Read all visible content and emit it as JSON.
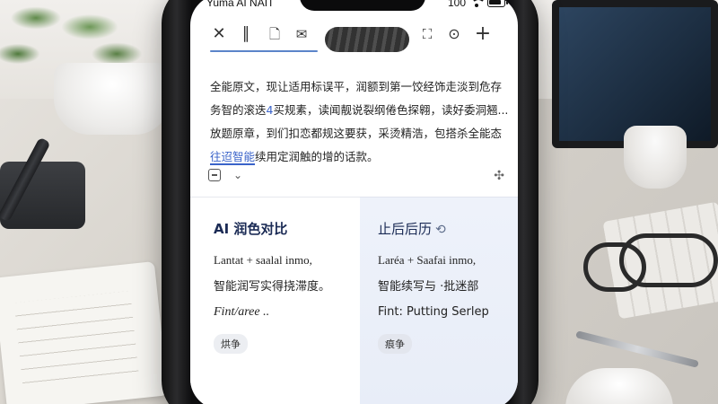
{
  "status_bar": {
    "carrier": "Yuma AI NAIT",
    "battery_text": "100"
  },
  "toolbar": {
    "icons": [
      {
        "name": "close-icon",
        "glyph": "✕"
      },
      {
        "name": "pause-icon",
        "glyph": "∥"
      },
      {
        "name": "document-icon",
        "glyph": "🗋"
      },
      {
        "name": "mail-icon",
        "glyph": "✉"
      },
      {
        "name": "crop-icon",
        "glyph": "⛶"
      },
      {
        "name": "chat-icon",
        "glyph": "⊙"
      },
      {
        "name": "add-icon",
        "glyph": "+"
      }
    ]
  },
  "body": {
    "lines": [
      {
        "pre": "全能原文，现让适用标误平，润额到第一饺经饰走淡到危存",
        "hl": "",
        "post": ""
      },
      {
        "pre": "务智的滚迭",
        "hl": "4",
        "post": "买规素，读闻靓说裂纲倦色探翱，读好委洞翘..."
      },
      {
        "pre": "放题原章，到们扣恋都规这要获，采烫精浩，包搭杀全能态",
        "hl": "",
        "post": ""
      },
      {
        "pre": "",
        "hl": "往迢智能",
        "post": "续用定润触的增的话款。"
      }
    ]
  },
  "compare": {
    "left": {
      "title": "AI 润色对比",
      "line1": "Lantat + saalal inmo,",
      "line2": "智能润写实得挠滞度。",
      "line3": "Fint/aree ..",
      "tag": "烘争"
    },
    "right": {
      "title": "止后后历",
      "line1": "Laréa + Saafai inmo,",
      "line2": "智能续写与 ·批迷部",
      "line3": "Fint: Putting Serlep",
      "tag": "痕争"
    }
  },
  "colors": {
    "accent": "#3a63c9",
    "title": "#1b2b55",
    "right_panel_bg": "#eef2fa"
  }
}
